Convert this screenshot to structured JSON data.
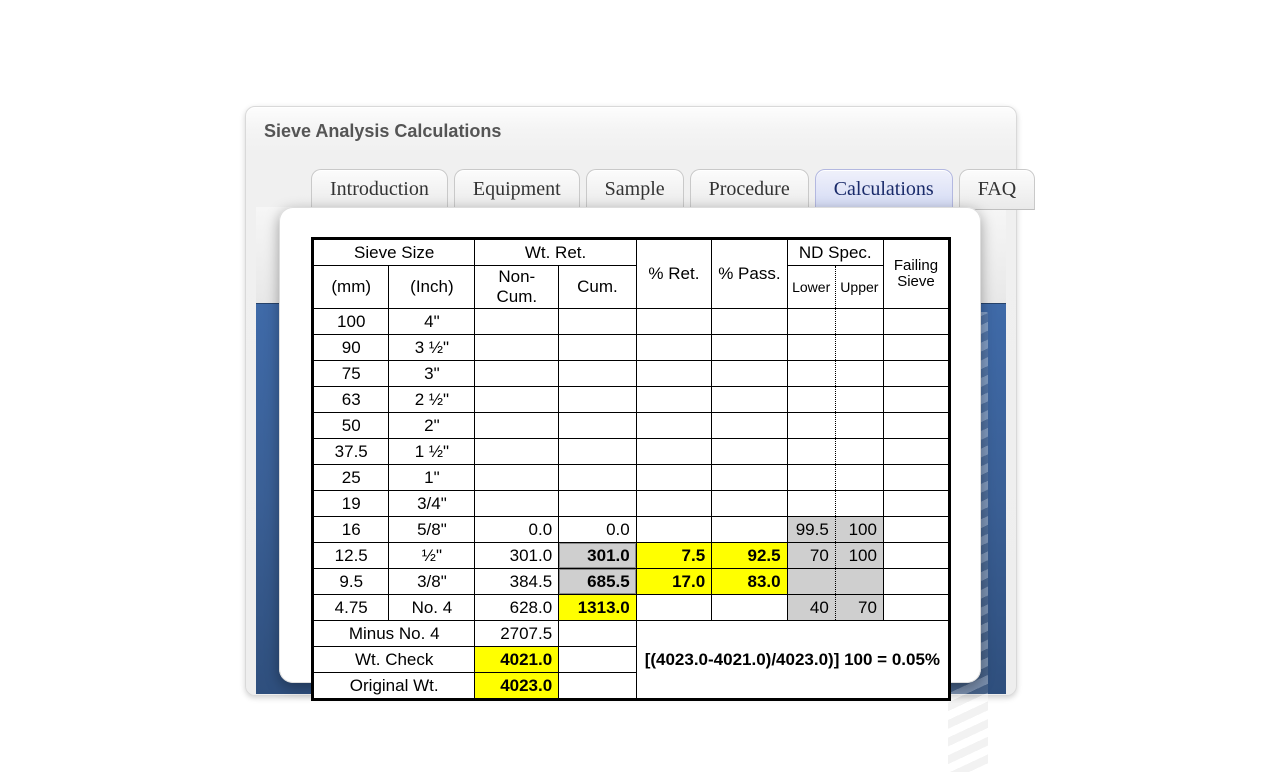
{
  "title": "Sieve Analysis Calculations",
  "tabs": {
    "introduction": "Introduction",
    "equipment": "Equipment",
    "sample": "Sample",
    "procedure": "Procedure",
    "calculations": "Calculations",
    "faq": "FAQ"
  },
  "headers": {
    "sieve_size": "Sieve Size",
    "mm": "(mm)",
    "inch": "(Inch)",
    "wt_ret": "Wt. Ret.",
    "non_cum": "Non-Cum.",
    "cum": "Cum.",
    "pct_ret": "% Ret.",
    "pct_pass": "% Pass.",
    "nd_spec": "ND Spec.",
    "lower": "Lower",
    "upper": "Upper",
    "failing": "Failing Sieve"
  },
  "rows": [
    {
      "mm": "100",
      "inch": "4\""
    },
    {
      "mm": "90",
      "inch": "3 ½\""
    },
    {
      "mm": "75",
      "inch": "3\""
    },
    {
      "mm": "63",
      "inch": "2 ½\""
    },
    {
      "mm": "50",
      "inch": "2\""
    },
    {
      "mm": "37.5",
      "inch": "1 ½\""
    },
    {
      "mm": "25",
      "inch": "1\""
    },
    {
      "mm": "19",
      "inch": "3/4\""
    },
    {
      "mm": "16",
      "inch": "5/8\"",
      "noncum": "0.0",
      "cum": "0.0",
      "lower": "99.5",
      "upper": "100"
    },
    {
      "mm": "12.5",
      "inch": "½\"",
      "noncum": "301.0",
      "cum": "301.0",
      "ret": "7.5",
      "pass": "92.5",
      "lower": "70",
      "upper": "100"
    },
    {
      "mm": "9.5",
      "inch": "3/8\"",
      "noncum": "384.5",
      "cum": "685.5",
      "ret": "17.0",
      "pass": "83.0"
    },
    {
      "mm": "4.75",
      "inch": "No. 4",
      "noncum": "628.0",
      "cum": "1313.0",
      "lower": "40",
      "upper": "70"
    }
  ],
  "footer": {
    "minus_no4_label": "Minus No. 4",
    "minus_no4_value": "2707.5",
    "wt_check_label": "Wt. Check",
    "wt_check_value": "4021.0",
    "orig_wt_label": "Original Wt.",
    "orig_wt_value": "4023.0",
    "formula": "[(4023.0-4021.0)/4023.0)] 100 = 0.05%"
  },
  "chart_data": {
    "type": "table",
    "title": "Sieve Analysis Calculations",
    "columns": [
      "mm",
      "inch",
      "Wt. Ret. Non-Cum.",
      "Wt. Ret. Cum.",
      "% Ret.",
      "% Pass.",
      "ND Spec. Lower",
      "ND Spec. Upper",
      "Failing Sieve"
    ],
    "rows": [
      [
        "100",
        "4\"",
        null,
        null,
        null,
        null,
        null,
        null,
        null
      ],
      [
        "90",
        "3 ½\"",
        null,
        null,
        null,
        null,
        null,
        null,
        null
      ],
      [
        "75",
        "3\"",
        null,
        null,
        null,
        null,
        null,
        null,
        null
      ],
      [
        "63",
        "2 ½\"",
        null,
        null,
        null,
        null,
        null,
        null,
        null
      ],
      [
        "50",
        "2\"",
        null,
        null,
        null,
        null,
        null,
        null,
        null
      ],
      [
        "37.5",
        "1 ½\"",
        null,
        null,
        null,
        null,
        null,
        null,
        null
      ],
      [
        "25",
        "1\"",
        null,
        null,
        null,
        null,
        null,
        null,
        null
      ],
      [
        "19",
        "3/4\"",
        null,
        null,
        null,
        null,
        null,
        null,
        null
      ],
      [
        "16",
        "5/8\"",
        0.0,
        0.0,
        null,
        null,
        99.5,
        100,
        null
      ],
      [
        "12.5",
        "½\"",
        301.0,
        301.0,
        7.5,
        92.5,
        70,
        100,
        null
      ],
      [
        "9.5",
        "3/8\"",
        384.5,
        685.5,
        17.0,
        83.0,
        null,
        null,
        null
      ],
      [
        "4.75",
        "No. 4",
        628.0,
        1313.0,
        null,
        null,
        40,
        70,
        null
      ]
    ],
    "summary": {
      "minus_no4": 2707.5,
      "wt_check": 4021.0,
      "original_wt": 4023.0,
      "percent_loss": 0.05,
      "formula": "[(4023.0-4021.0)/4023.0)] 100 = 0.05%"
    }
  }
}
